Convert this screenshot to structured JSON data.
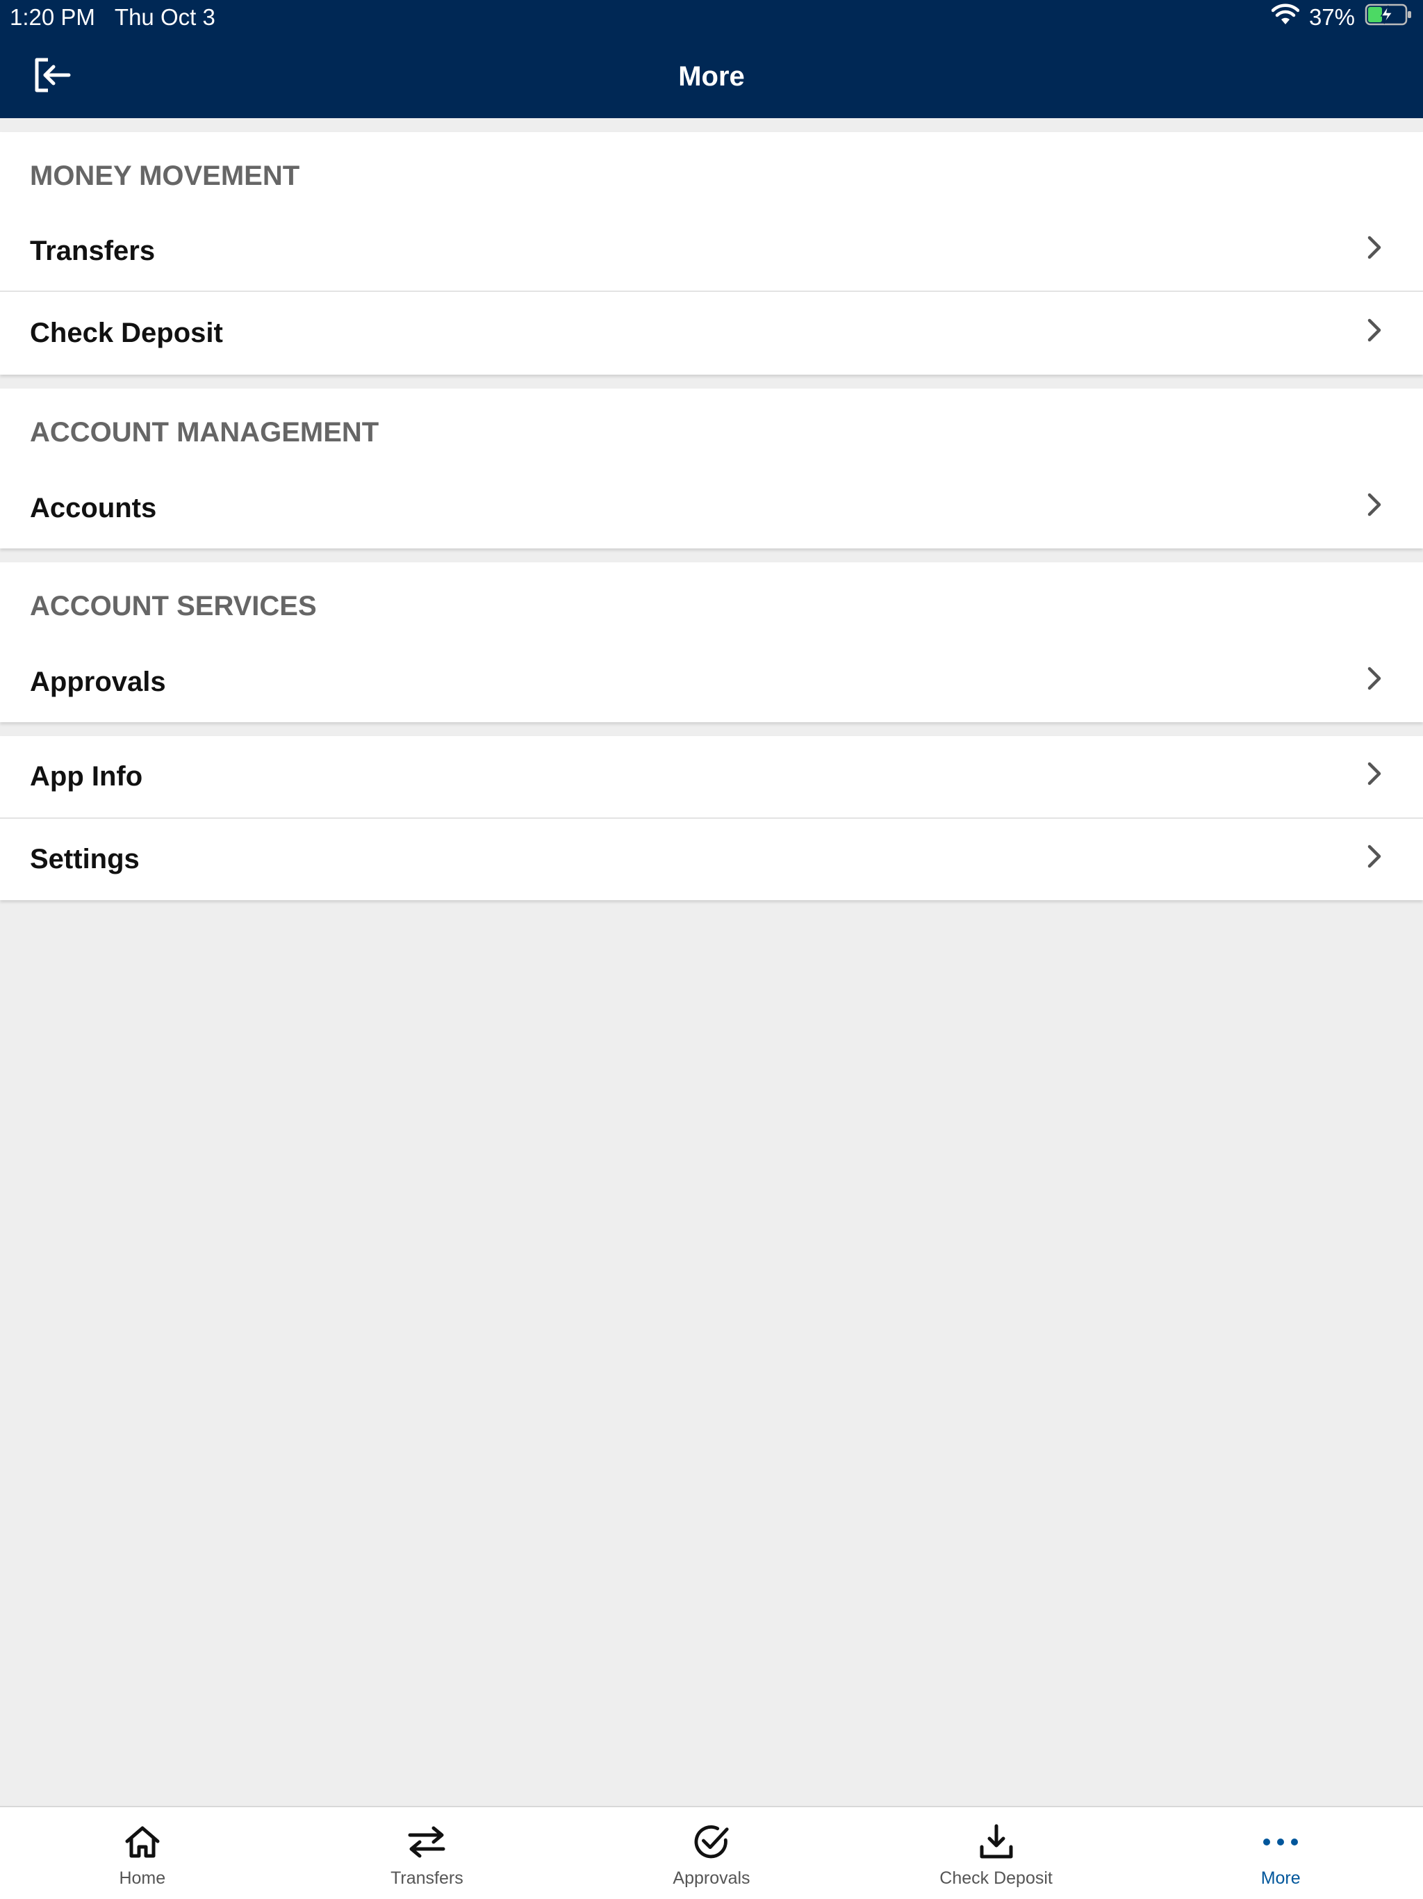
{
  "status_bar": {
    "time": "1:20 PM",
    "date": "Thu Oct 3",
    "battery": "37%",
    "battery_level": 0.37
  },
  "header": {
    "title": "More"
  },
  "sections": {
    "money_movement": {
      "title": "MONEY MOVEMENT",
      "items": [
        {
          "label": "Transfers"
        },
        {
          "label": "Check Deposit"
        }
      ]
    },
    "account_management": {
      "title": "ACCOUNT MANAGEMENT",
      "items": [
        {
          "label": "Accounts"
        }
      ]
    },
    "account_services": {
      "title": "ACCOUNT SERVICES",
      "items": [
        {
          "label": "Approvals"
        }
      ]
    },
    "other": {
      "items": [
        {
          "label": "App Info"
        },
        {
          "label": "Settings"
        }
      ]
    }
  },
  "tab_bar": {
    "tabs": [
      {
        "label": "Home",
        "icon": "home-icon"
      },
      {
        "label": "Transfers",
        "icon": "transfer-arrows-icon"
      },
      {
        "label": "Approvals",
        "icon": "check-circle-icon"
      },
      {
        "label": "Check Deposit",
        "icon": "download-tray-icon"
      },
      {
        "label": "More",
        "icon": "ellipsis-icon",
        "active": true
      }
    ]
  },
  "colors": {
    "header_bg": "#002855",
    "active_tab": "#00569b",
    "section_title": "#666666",
    "background": "#eeeeee",
    "battery_green": "#4cd964"
  }
}
